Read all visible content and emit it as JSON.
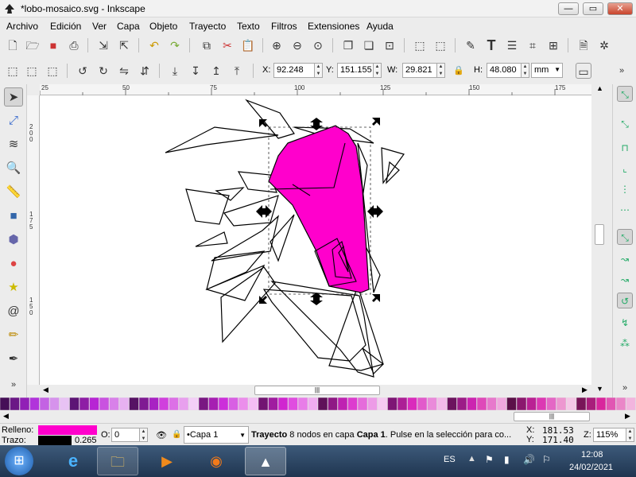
{
  "window": {
    "title": "*lobo-mosaico.svg - Inkscape",
    "min_label": "—",
    "max_label": "▭",
    "close_label": "✕"
  },
  "menu": [
    "Archivo",
    "Edición",
    "Ver",
    "Capa",
    "Objeto",
    "Trayecto",
    "Texto",
    "Filtros",
    "Extensiones",
    "Ayuda"
  ],
  "toolcontrols": {
    "x_label": "X:",
    "x_value": "92.248",
    "y_label": "Y:",
    "y_value": "151.155",
    "w_label": "W:",
    "w_value": "29.821",
    "h_label": "H:",
    "h_value": "48.080",
    "unit": "mm"
  },
  "rulers": {
    "h": [
      "25",
      "50",
      "75",
      "100",
      "125",
      "150",
      "175"
    ],
    "v": [
      "200",
      "175",
      "150"
    ]
  },
  "canvas": {
    "selection_fill": "#ff00cc"
  },
  "status": {
    "fill_label": "Relleno:",
    "stroke_label": "Trazo:",
    "stroke_width": "0.265",
    "opacity_label": "O:",
    "opacity_value": "0",
    "layer": "•Capa 1",
    "message_bold": "Trayecto",
    "message_rest": " 8 nodos en capa ",
    "message_layer": "Capa 1",
    "message_tail": ". Pulse en la selección para co...",
    "cursor_x_label": "X:",
    "cursor_x": "181.53",
    "cursor_y_label": "Y:",
    "cursor_y": "171.40",
    "zoom_label": "Z:",
    "zoom_value": "115%"
  },
  "taskbar": {
    "lang": "ES",
    "time": "12:08",
    "date": "24/02/2021"
  },
  "colors": {
    "fill": "#ff00cc",
    "stroke": "#000000"
  }
}
